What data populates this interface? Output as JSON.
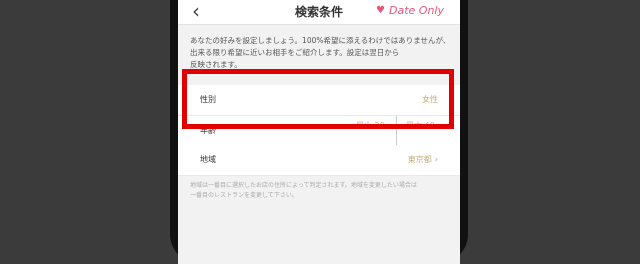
{
  "navbar": {
    "back_icon": "chevron-left-icon",
    "title": "検索条件",
    "date_only_label": "Date Only",
    "date_only_icon": "heart-icon"
  },
  "description": "あなたの好みを設定しましょう。100%希望に添えるわけではありませんが、出来る限り希望に近いお相手をご紹介します。設定は翌日から\n反映されます。",
  "rows": {
    "gender": {
      "label": "性別",
      "value": "女性"
    },
    "age": {
      "label": "年齢",
      "min": "最小 20",
      "max": "最大 40"
    },
    "region": {
      "label": "地域",
      "value": "東京都"
    }
  },
  "note": "地域は一番目に選択したお店の住所によって判定されます。地域を変更したい場合は\n一番目のレストランを変更して下さい。",
  "colors": {
    "accent_pink": "#e4577a",
    "value_gold": "#c9ae7a",
    "highlight_red": "#e00000"
  }
}
